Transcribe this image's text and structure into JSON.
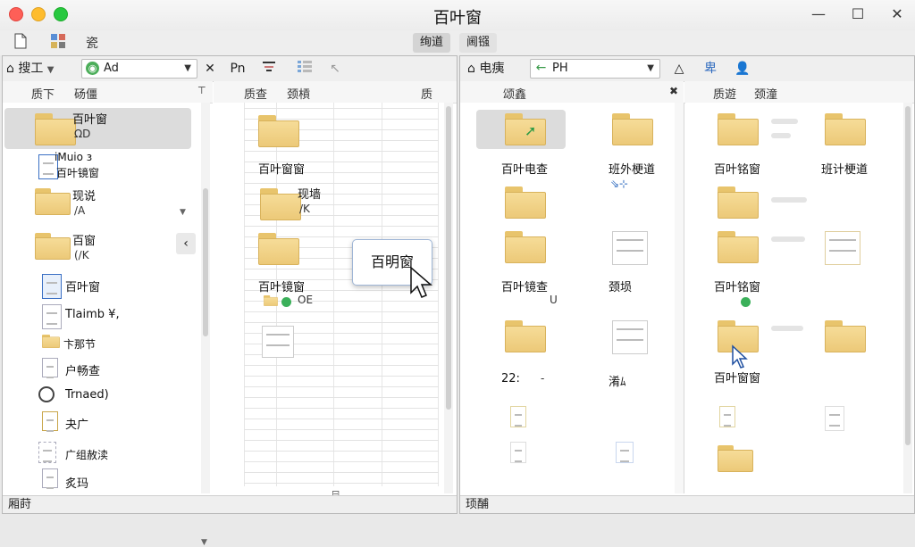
{
  "window": {
    "title": "百叶窗"
  },
  "toolbar": {
    "new_label": "",
    "tools_label": "",
    "text_label": "瓷",
    "tabs": [
      "绚道",
      "阃镪"
    ]
  },
  "left_pane": {
    "nav_label": "搜工",
    "address": "Ad",
    "btn_a": "Pn",
    "headers": {
      "col1": "质下",
      "col2": "砀僵",
      "col3": "质查",
      "col4": "颈槓",
      "col5": "质"
    },
    "tree": [
      {
        "name": "百叶窗",
        "sub": "ΩD"
      },
      {
        "name": "iMuio з",
        "sub": "百叶镜窗"
      },
      {
        "name": "现说",
        "sub": "/A"
      },
      {
        "name": "百窗",
        "sub": "(/K"
      },
      {
        "name": "百叶窗",
        "sub": ""
      },
      {
        "name": "Tlaimb  ¥,",
        "sub": ""
      },
      {
        "name": "卞那节",
        "sub": ""
      },
      {
        "name": "户畅查",
        "sub": ""
      },
      {
        "name": "Trnaed)",
        "sub": ""
      },
      {
        "name": "夬广",
        "sub": ""
      },
      {
        "name": "广组赦渎",
        "sub": ""
      },
      {
        "name": "炙玛",
        "sub": ""
      }
    ],
    "files": [
      {
        "name": "百叶窗窗",
        "sub": ""
      },
      {
        "name": "现墙",
        "sub": "/K"
      },
      {
        "name": "百叶镜窗",
        "sub": "OE"
      }
    ],
    "tooltip": "百明窗",
    "status": "厢莳"
  },
  "right_pane": {
    "nav_label": "电痍",
    "address": "РΗ",
    "btn_b": "卑",
    "headers": {
      "col1": "颂鑫",
      "col2": "质遊",
      "col3": "颈潼"
    },
    "icons_mid": [
      {
        "name": "百叶电查"
      },
      {
        "name": "班外梗道"
      },
      {
        "name": "百叶镜查",
        "sub": "U"
      },
      {
        "name": "颈埙"
      },
      {
        "name": "22:",
        "sub": "-"
      },
      {
        "name": "淆ﾑ"
      }
    ],
    "icons_right": [
      {
        "name": "百叶铭窗"
      },
      {
        "name": "班计梗道"
      },
      {
        "name": "百叶铭窗"
      },
      {
        "name": "百叶窗窗"
      }
    ],
    "status": "顼酺"
  }
}
